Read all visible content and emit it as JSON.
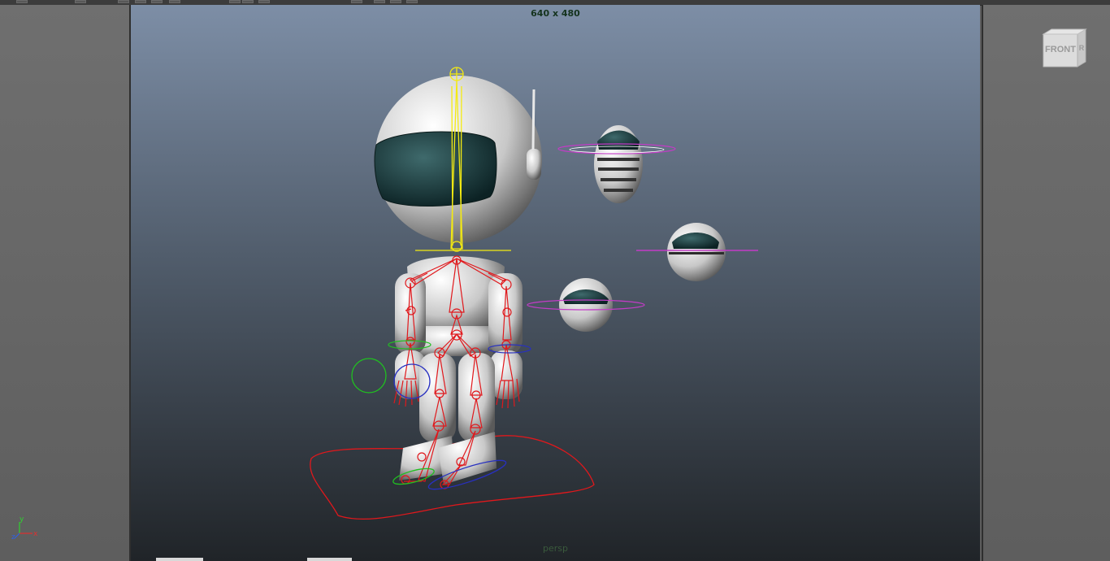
{
  "viewport": {
    "resolution_label": "640 x 480",
    "camera_label": "persp"
  },
  "view_cube": {
    "face_label": "FRONT",
    "side_label": "R"
  },
  "axis_gizmo": {
    "y_label": "y",
    "x_label": "x",
    "z_label": "z"
  },
  "colors": {
    "joint": "#e0181c",
    "head_joint": "#f4ea12",
    "ring_magenta": "#c23cc6",
    "ctrl_green": "#20c020",
    "ctrl_blue": "#2830c0",
    "visor": "#1a3a3c"
  },
  "icons": {
    "view_cube": "view-cube-icon",
    "axis": "axis-gizmo-icon"
  }
}
